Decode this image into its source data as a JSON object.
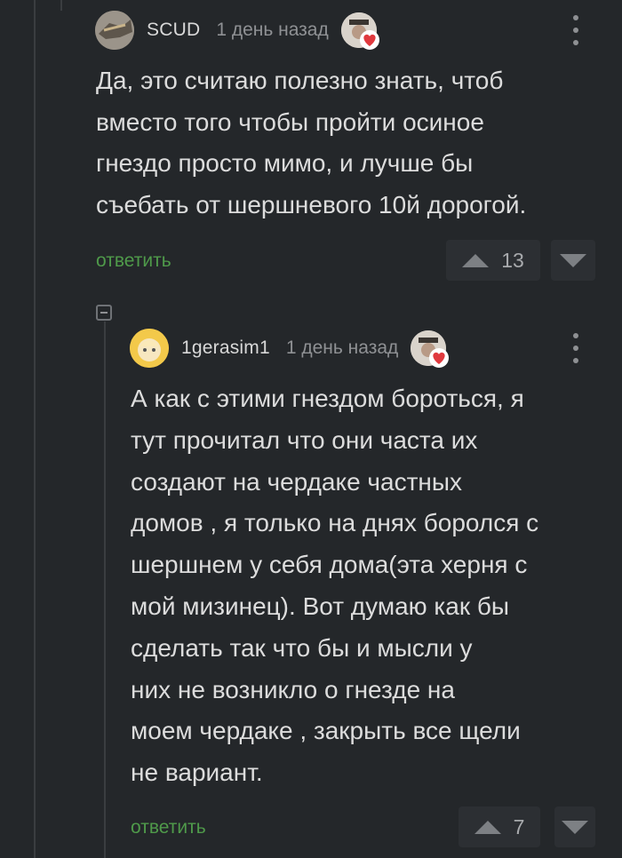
{
  "comments": [
    {
      "author": "SCUD",
      "time": "1 день назад",
      "text": "Да, это считаю полезно знать, чтоб\nвместо того чтобы пройти осиное\nгнездо просто мимо, и лучше бы\nсъебать от шершневого 10й дорогой.",
      "reply_label": "ответить",
      "score": "13"
    },
    {
      "author": "1gerasim1",
      "time": "1 день назад",
      "text": "А как с этими гнездом бороться, я\nтут прочитал что они часта их\nсоздают на чердаке частных\nдомов , я только на днях боролся с\nшершнем у себя дома(эта херня с\nмой мизинец). Вот думаю как бы\nсделать так что бы и мысли у\nних не возникло о гнезде на\nмоем чердаке , закрыть все щели\nне вариант.",
      "reply_label": "ответить",
      "score": "7"
    }
  ],
  "icons": {
    "heart_color": "#e0393e",
    "reply_color": "#4f9a4a",
    "background": "#24272a"
  }
}
